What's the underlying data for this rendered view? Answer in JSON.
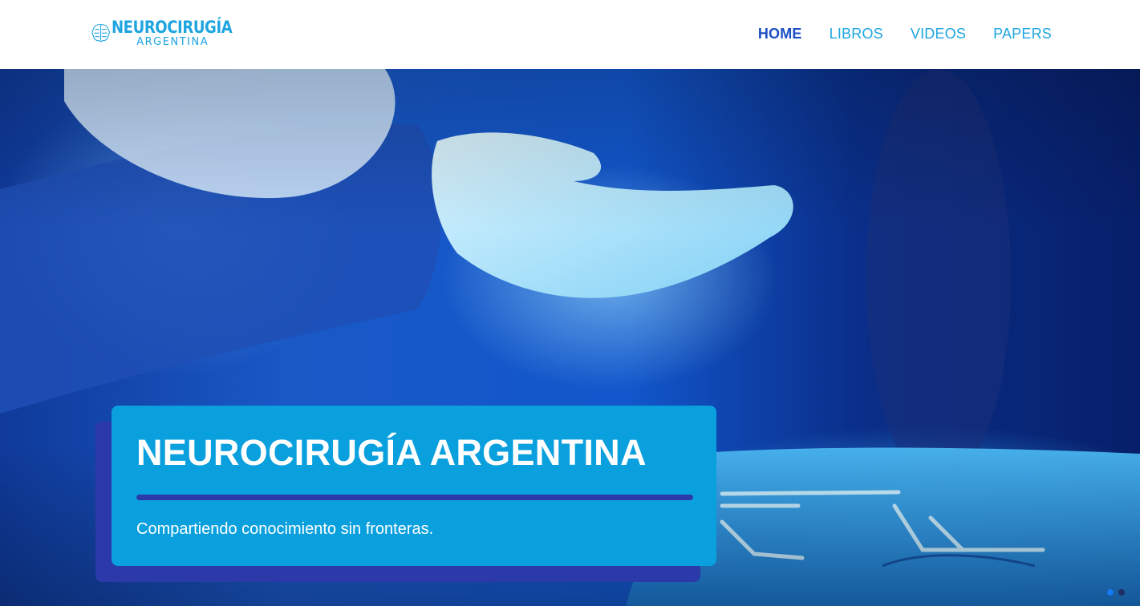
{
  "brand": {
    "line1": "NEUROCIRUGÍA",
    "line2": "ARGENTINA",
    "icon": "brain-icon",
    "color": "#1ea5e0"
  },
  "nav": {
    "items": [
      {
        "label": "HOME",
        "active": true
      },
      {
        "label": "LIBROS",
        "active": false
      },
      {
        "label": "VIDEOS",
        "active": false
      },
      {
        "label": "PAPERS",
        "active": false
      }
    ],
    "active_color": "#1c4fc4",
    "color": "#1ea5e0"
  },
  "hero": {
    "title": "NEUROCIRUGÍA ARGENTINA",
    "subtitle": "Compartiendo conocimiento sin fronteras.",
    "card_color": "#0aa0de",
    "card_shadow_color": "#2b3aa8",
    "image": "surgeon-gloved-hand-over-instrument-tray",
    "slides": [
      {
        "active": true,
        "color": "#1877f2"
      },
      {
        "active": false,
        "color": "#1f2f66"
      }
    ]
  }
}
